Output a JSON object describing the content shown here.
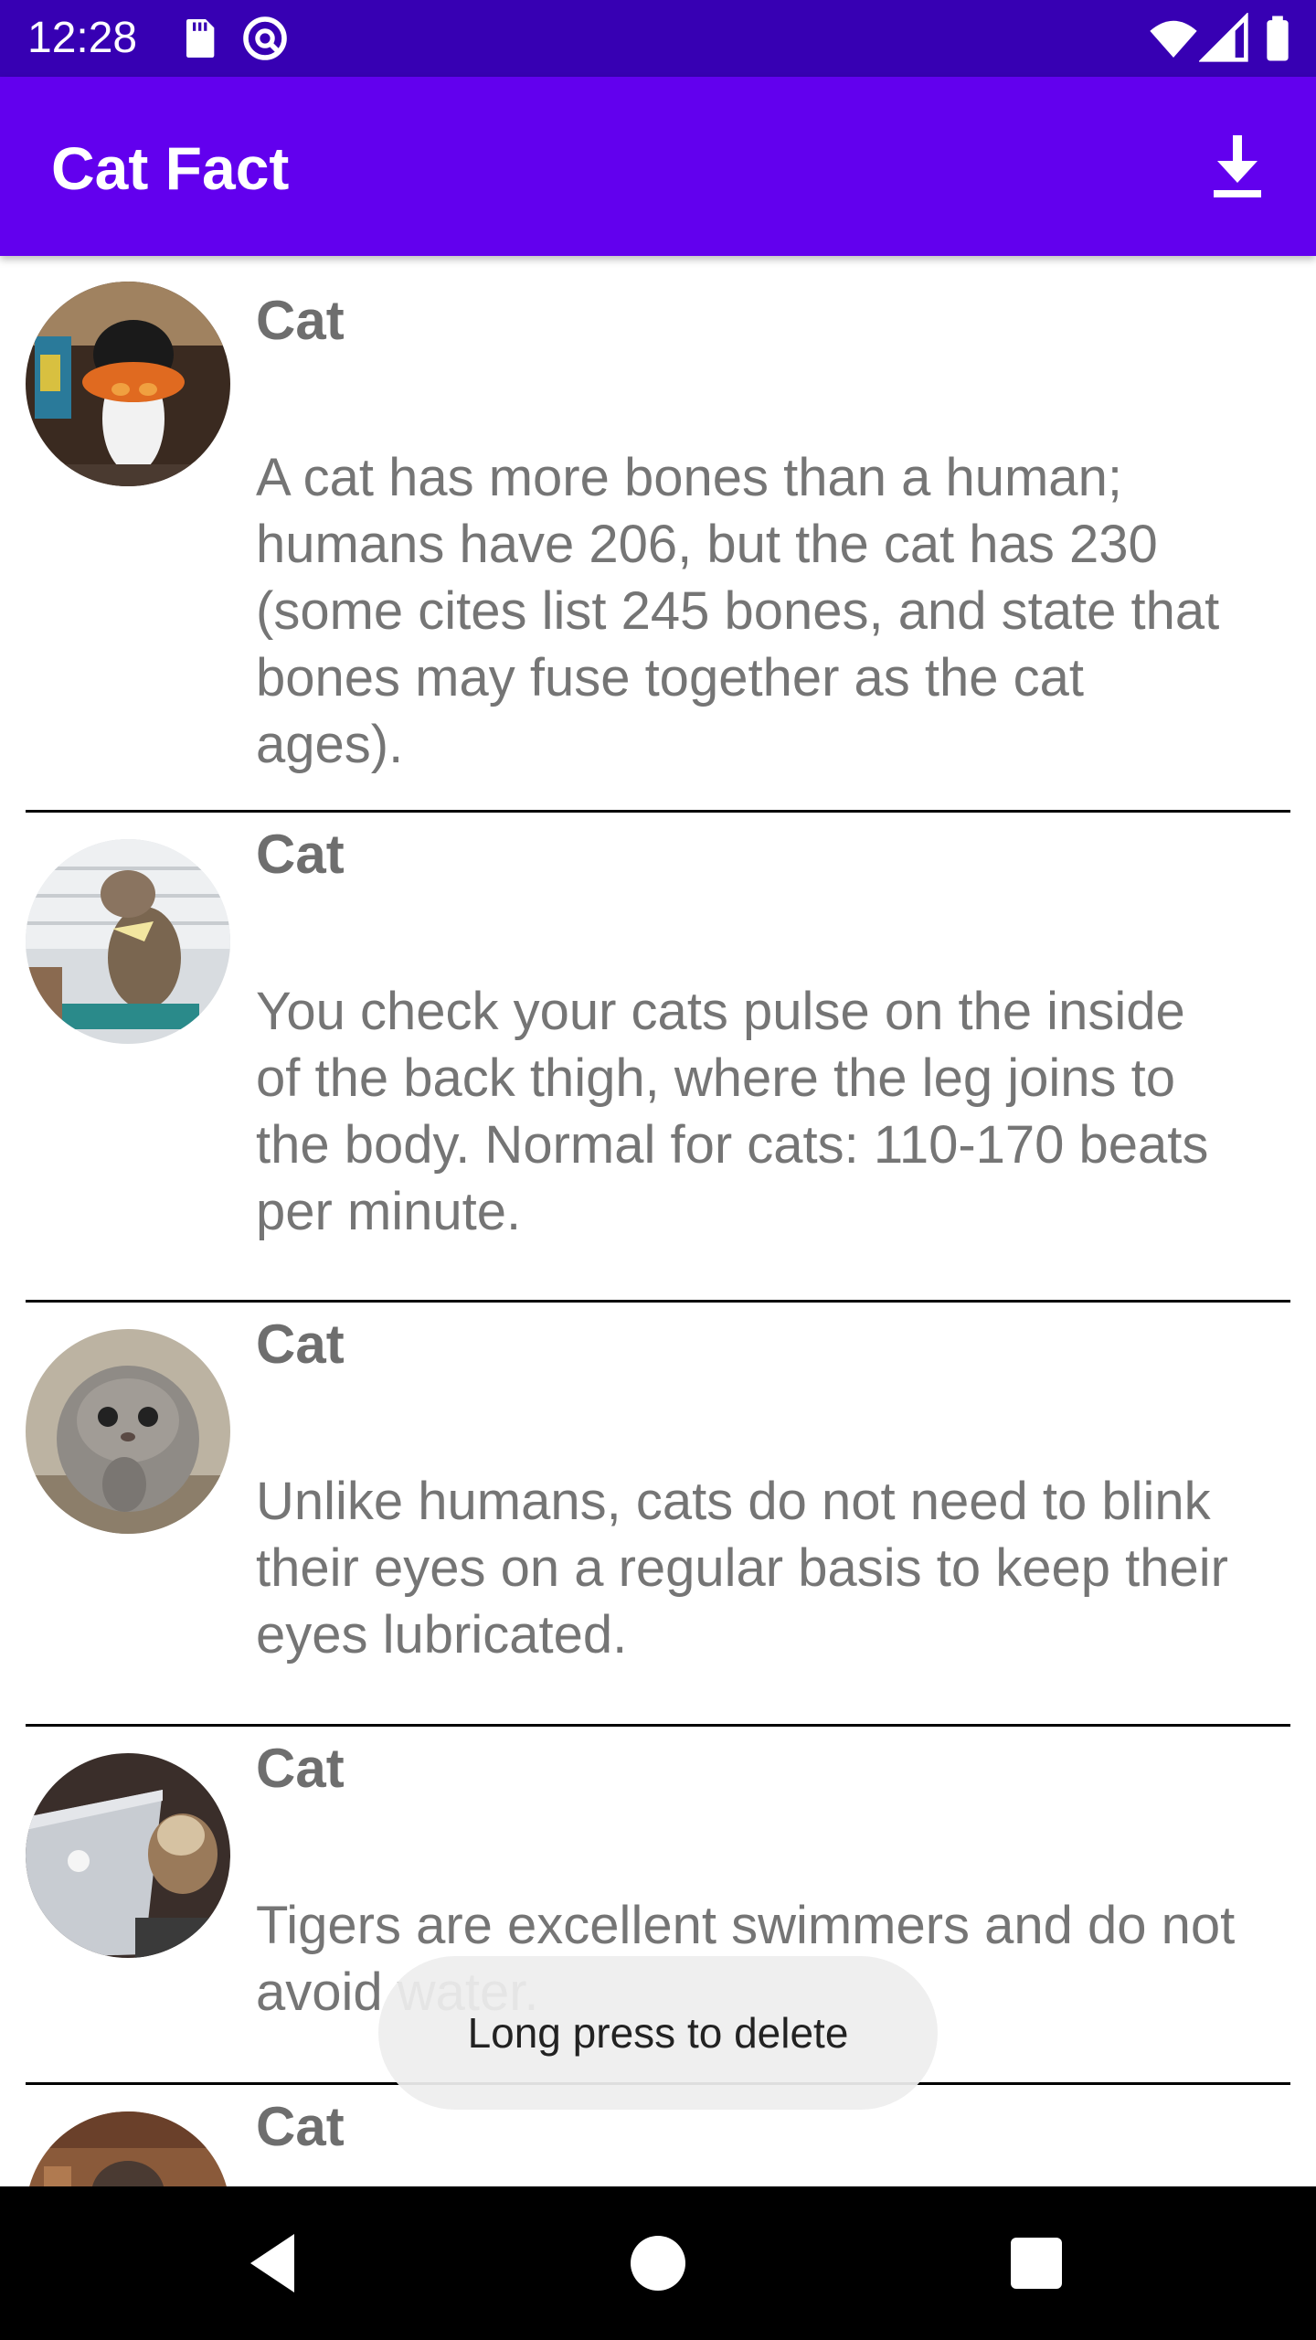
{
  "status_bar": {
    "time": "12:28",
    "icons": [
      "sd-card-icon",
      "sync-icon",
      "wifi-icon",
      "signal-icon",
      "battery-icon"
    ]
  },
  "app_bar": {
    "title": "Cat Fact",
    "action_icon": "download-icon"
  },
  "facts": [
    {
      "title": "Cat",
      "text": "A cat has more bones than a human; humans have 206, but the cat has 230 (some cites list 245 bones, and state that bones may fuse together as the cat ages)."
    },
    {
      "title": "Cat",
      "text": "You check your cats pulse on the inside of the back thigh, where the leg joins to the body. Normal for cats: 110-170 beats per minute."
    },
    {
      "title": "Cat",
      "text": "Unlike humans, cats do not need to blink their eyes on a regular basis to keep their eyes lubricated."
    },
    {
      "title": "Cat",
      "text": "Tigers are excellent swimmers and do not avoid water."
    },
    {
      "title": "Cat",
      "text": ""
    }
  ],
  "toast": {
    "message": "Long press to delete"
  },
  "nav_bar": {
    "icons": [
      "back-icon",
      "home-icon",
      "recents-icon"
    ]
  },
  "colors": {
    "status_bar": "#3700b3",
    "app_bar": "#6200ee",
    "title_text": "#6e6e6e",
    "body_text": "#757575",
    "divider": "#000000"
  }
}
